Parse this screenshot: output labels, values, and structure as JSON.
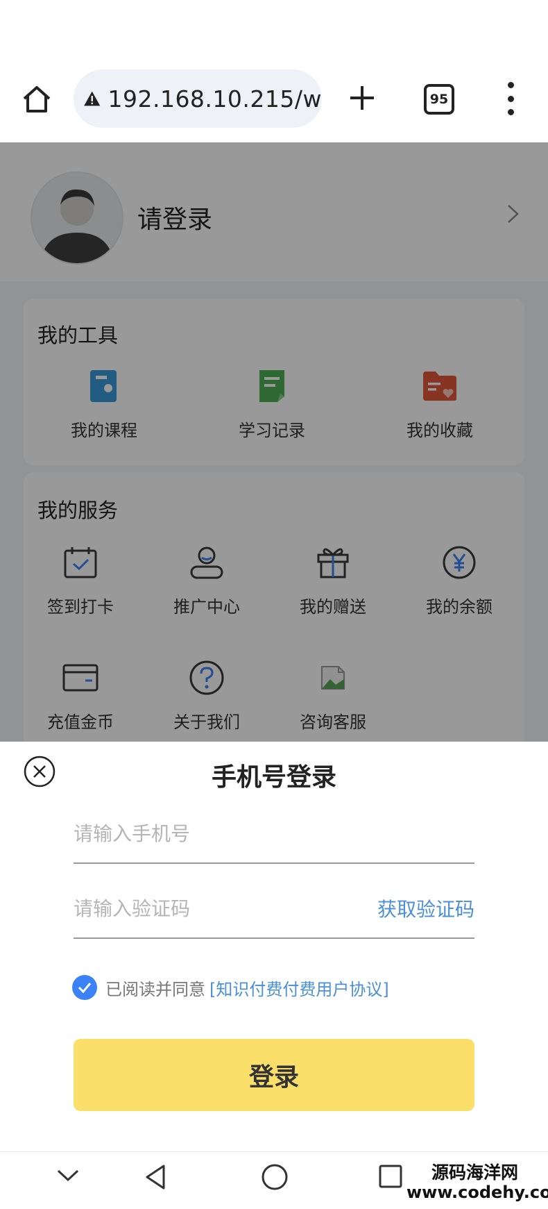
{
  "browser": {
    "url": "192.168.10.215/w",
    "tab_count": "95"
  },
  "profile": {
    "login_prompt": "请登录"
  },
  "tools": {
    "title": "我的工具",
    "items": [
      {
        "label": "我的课程",
        "icon": "course-book-icon",
        "color": "#3b9ad9"
      },
      {
        "label": "学习记录",
        "icon": "study-record-icon",
        "color": "#4caf50"
      },
      {
        "label": "我的收藏",
        "icon": "favorites-folder-icon",
        "color": "#e2573b"
      }
    ]
  },
  "services": {
    "title": "我的服务",
    "items": [
      {
        "label": "签到打卡",
        "icon": "calendar-check-icon"
      },
      {
        "label": "推广中心",
        "icon": "user-icon"
      },
      {
        "label": "我的赠送",
        "icon": "gift-icon"
      },
      {
        "label": "我的余额",
        "icon": "yuan-coin-icon"
      },
      {
        "label": "充值金币",
        "icon": "card-icon"
      },
      {
        "label": "关于我们",
        "icon": "question-circle-icon"
      },
      {
        "label": "咨询客服",
        "icon": "broken-image-icon"
      }
    ]
  },
  "login_sheet": {
    "title": "手机号登录",
    "phone_placeholder": "请输入手机号",
    "code_placeholder": "请输入验证码",
    "get_code": "获取验证码",
    "agree_text": "已阅读并同意",
    "agreement_link": "[知识付费付费用户协议]",
    "agreed": true,
    "login_button": "登录"
  },
  "watermark": {
    "title": "源码海洋网",
    "url": "www.codehy.com"
  },
  "colors": {
    "login_button": "#fae06b",
    "link": "#4a8fd8",
    "checkbox": "#3b82f6"
  }
}
